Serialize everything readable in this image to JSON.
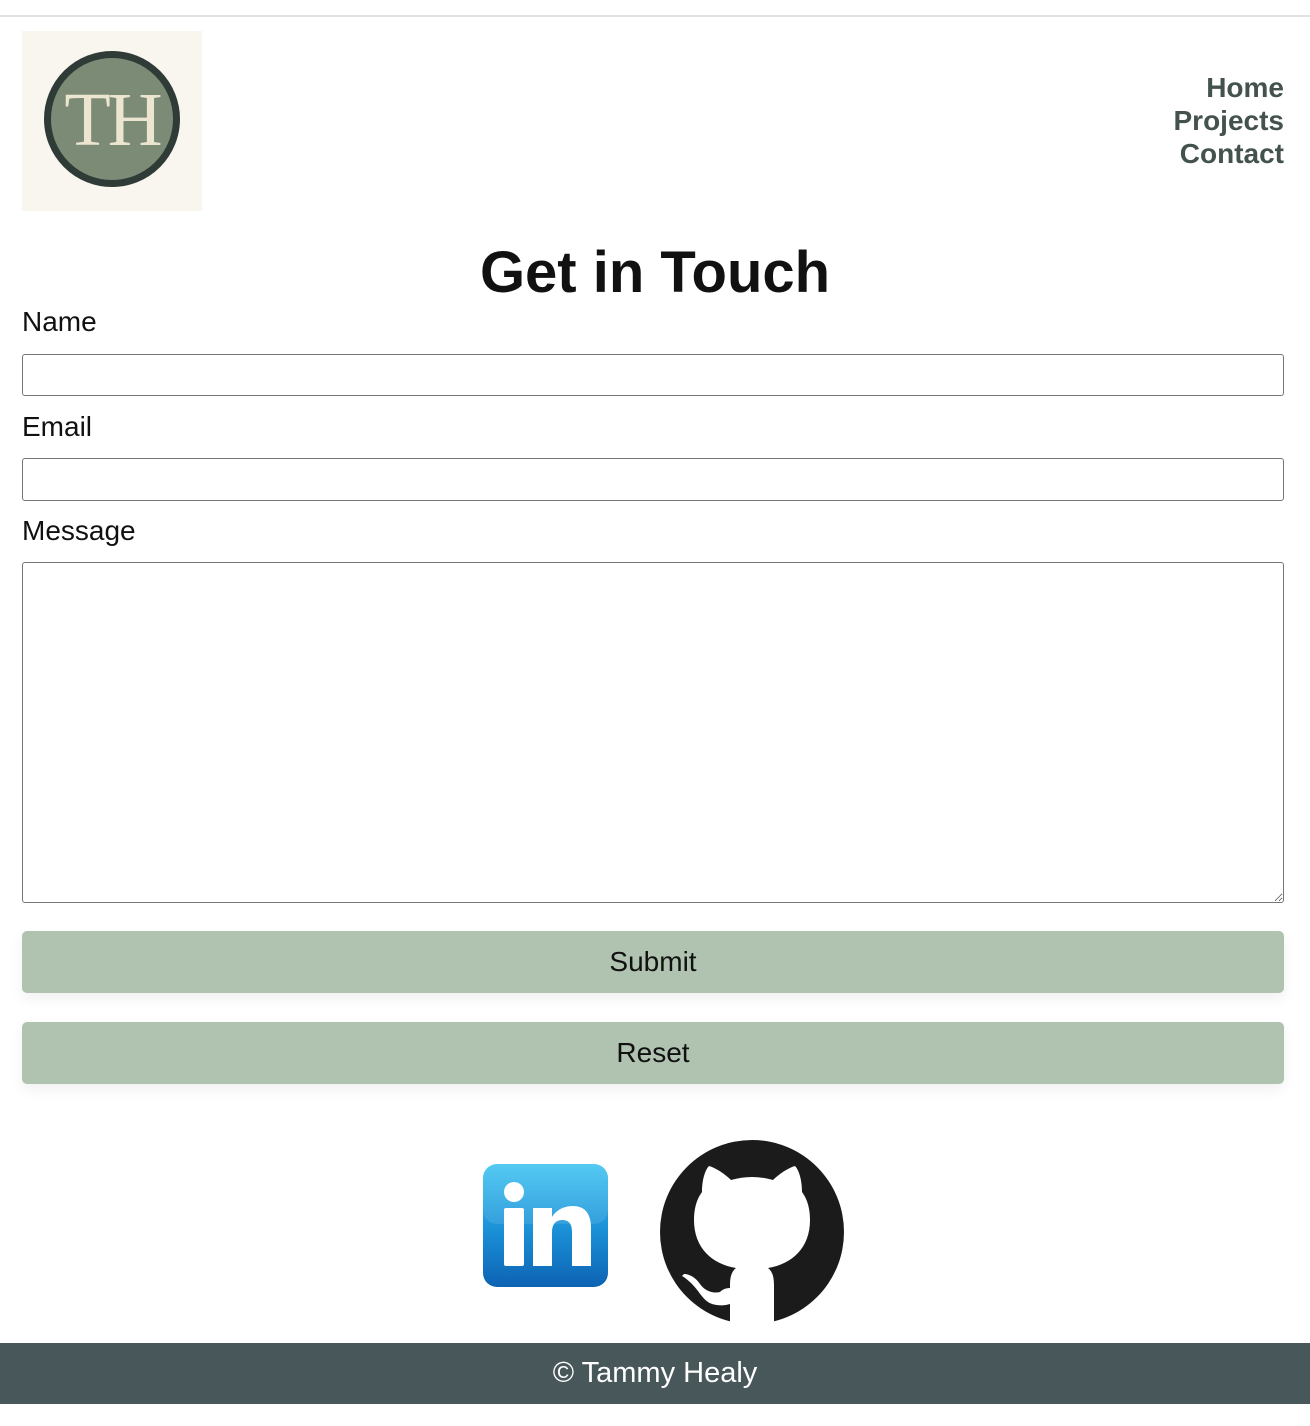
{
  "header": {
    "logo_text": "TH",
    "nav": [
      {
        "label": "Home"
      },
      {
        "label": "Projects"
      },
      {
        "label": "Contact"
      }
    ]
  },
  "main": {
    "title": "Get in Touch",
    "form": {
      "name_label": "Name",
      "name_value": "",
      "email_label": "Email",
      "email_value": "",
      "message_label": "Message",
      "message_value": "",
      "submit_label": "Submit",
      "reset_label": "Reset"
    }
  },
  "social": {
    "linkedin_icon": "linkedin-icon",
    "github_icon": "github-icon"
  },
  "footer": {
    "text": "© Tammy Healy"
  },
  "colors": {
    "nav_text": "#44524e",
    "button_bg": "#b0c3b1",
    "footer_bg": "#48575a",
    "logo_bg": "#7c8b76",
    "logo_ring": "#2f3b36"
  }
}
